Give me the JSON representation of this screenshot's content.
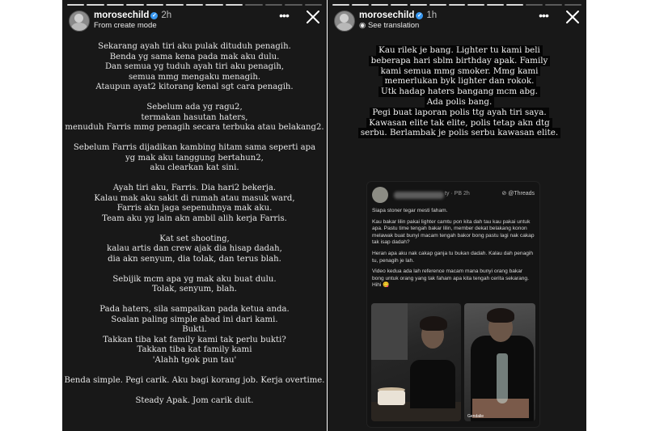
{
  "left_story": {
    "progress": [
      1,
      1,
      1,
      1,
      1,
      1,
      1,
      1,
      1,
      0,
      0,
      0,
      0
    ],
    "username": "morosechild",
    "time": "2h",
    "subline": "From create mode",
    "lines": [
      "Sekarang ayah tiri aku pulak dituduh penagih.",
      "Benda yg sama kena pada mak aku dulu.",
      "Dan semua yg tuduh ayah tiri aku penagih,",
      "semua mmg mengaku menagih.",
      "Ataupun ayat2 kitorang kenal sgt cara penagih.",
      "",
      "Sebelum ada yg ragu2,",
      "termakan hasutan haters,",
      "menuduh Farris mmg penagih secara terbuka atau belakang2.",
      "",
      "Sebelum Farris dijadikan kambing hitam sama seperti apa",
      "yg mak aku tanggung bertahun2,",
      "aku clearkan kat sini.",
      "",
      "Ayah tiri aku, Farris. Dia hari2 bekerja.",
      "Kalau mak aku sakit di rumah atau masuk ward,",
      "Farris akn jaga sepenuhnya mak aku.",
      "Team aku yg lain akn ambil alih kerja Farris.",
      "",
      "Kat set shooting,",
      "kalau artis dan crew ajak dia hisap dadah,",
      "dia akn senyum, dia tolak, dan terus blah.",
      "",
      "Sebijik mcm apa yg mak aku buat dulu.",
      "Tolak, senyum, blah.",
      "",
      "Pada haters, sila sampaikan pada ketua anda.",
      "Soalan paling simple abad ini dari kami.",
      "Bukti.",
      "Takkan tiba kat family kami tak perlu bukti?",
      "Takkan tiba kat family kami",
      "'Alahh tgok pun tau'",
      "",
      "Benda simple. Pegi carik. Aku bagi korang job. Kerja overtime.",
      "",
      "Steady Apak. Jom carik duit."
    ]
  },
  "right_story": {
    "progress": [
      1,
      1,
      1,
      1,
      1,
      1,
      1,
      1,
      1,
      1,
      0,
      0,
      0
    ],
    "username": "morosechild",
    "time": "1h",
    "subline": "See translation",
    "lines": [
      "Kau rilek je bang. Lighter tu kami beli",
      "beberapa hari sblm birthday apak. Family",
      "kami semua mmg smoker. Mmg kami",
      "memerlukan byk lighter dan rokok.",
      "Utk hadap haters bangang mcm abg.",
      "Ada polis bang.",
      "Pegi buat laporan polis ttg ayah tiri saya.",
      "Kawasan elite tak elite, polis tetap akn dtg",
      "serbu. Berlambak je polis serbu kawasan elite."
    ],
    "post": {
      "meta": "ty · PB 2h",
      "threads_label": "Threads",
      "paragraphs": [
        "Siapa stoner tegar mesti faham.",
        "Kau bakar lilin pakai lighter camtu pon kita dah tau kau pakai untuk apa. Pastu time tengah bakar lilin, member dekat belakang konon melawak buat bunyi macam tengah bakor bong pastu lagi nak cakap tak isap dadah?",
        "Heran apa aku nak cakap ganja tu bukan dadah. Kalau dah penagih tu, penagih je lah.",
        "Video kedua ada lah reference macam mana bunyi orang bakar bong untuk orang yang tak faham apa kita tengah cerita sekarang. Hihi 😋"
      ],
      "photo_labels": [
        "",
        "Gendalie"
      ]
    }
  }
}
